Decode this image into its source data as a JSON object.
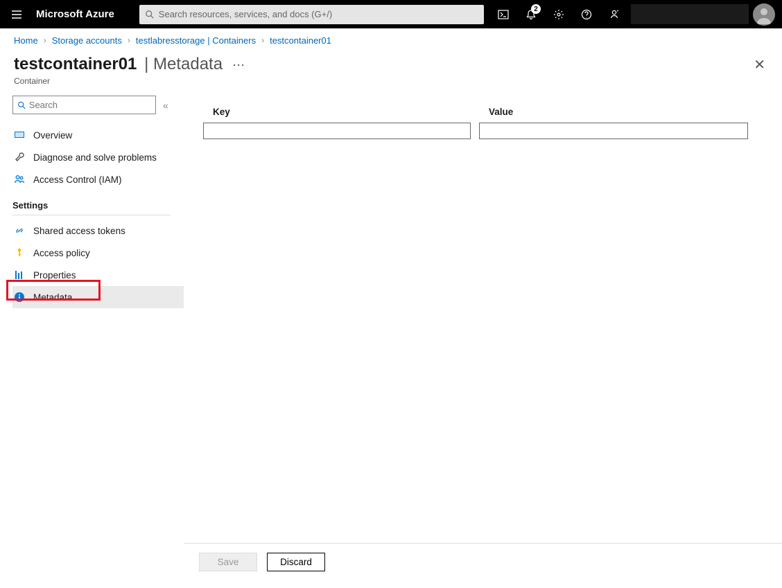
{
  "topbar": {
    "brand": "Microsoft Azure",
    "search_placeholder": "Search resources, services, and docs (G+/)",
    "notification_count": "2"
  },
  "breadcrumbs": {
    "items": [
      {
        "label": "Home"
      },
      {
        "label": "Storage accounts"
      },
      {
        "label": "testlabresstorage | Containers"
      },
      {
        "label": "testcontainer01"
      }
    ]
  },
  "title": {
    "name": "testcontainer01",
    "section": "Metadata",
    "subtitle": "Container"
  },
  "sidebar": {
    "search_placeholder": "Search",
    "items": [
      {
        "label": "Overview"
      },
      {
        "label": "Diagnose and solve problems"
      },
      {
        "label": "Access Control (IAM)"
      }
    ],
    "settings_header": "Settings",
    "settings_items": [
      {
        "label": "Shared access tokens"
      },
      {
        "label": "Access policy"
      },
      {
        "label": "Properties"
      },
      {
        "label": "Metadata"
      }
    ]
  },
  "grid": {
    "headers": {
      "key": "Key",
      "value": "Value"
    },
    "row": {
      "key": "",
      "value": ""
    }
  },
  "footer": {
    "save_label": "Save",
    "discard_label": "Discard"
  }
}
